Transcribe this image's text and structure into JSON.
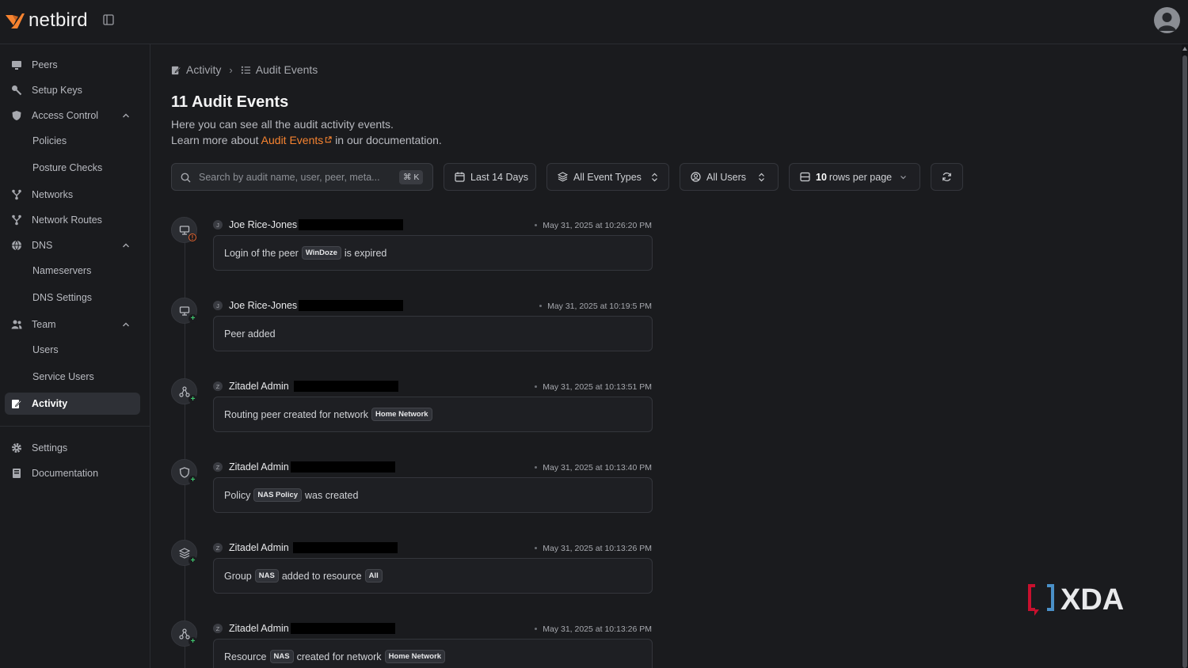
{
  "app": {
    "brand": "netbird",
    "accent": "#f68330"
  },
  "sidebar": {
    "items": [
      {
        "label": "Peers"
      },
      {
        "label": "Setup Keys"
      },
      {
        "label": "Access Control"
      },
      {
        "label": "Policies"
      },
      {
        "label": "Posture Checks"
      },
      {
        "label": "Networks"
      },
      {
        "label": "Network Routes"
      },
      {
        "label": "DNS"
      },
      {
        "label": "Nameservers"
      },
      {
        "label": "DNS Settings"
      },
      {
        "label": "Team"
      },
      {
        "label": "Users"
      },
      {
        "label": "Service Users"
      },
      {
        "label": "Activity"
      },
      {
        "label": "Settings"
      },
      {
        "label": "Documentation"
      }
    ],
    "active": "Activity"
  },
  "breadcrumb": {
    "parent": "Activity",
    "current": "Audit Events"
  },
  "header": {
    "title": "11 Audit Events",
    "description": "Here you can see all the audit activity events.",
    "learn_prefix": "Learn more about",
    "learn_link": "Audit Events",
    "learn_suffix": "in our documentation."
  },
  "filters": {
    "search_placeholder": "Search by audit name, user, peer, meta...",
    "search_shortcut": "⌘ K",
    "date_range": "Last 14 Days",
    "event_type": "All Event Types",
    "users": "All Users",
    "rows_value": "10",
    "rows_suffix": "rows per page"
  },
  "events": [
    {
      "initial": "J",
      "user": "Joe Rice-Jones",
      "time": "May 31, 2025 at 10:26:20 PM",
      "icon": "peer-expired-icon",
      "badge": "warning",
      "text_before": "Login of the peer",
      "chip": "WinDoze",
      "text_after": "is expired"
    },
    {
      "initial": "J",
      "user": "Joe Rice-Jones",
      "time": "May 31, 2025 at 10:19:5 PM",
      "icon": "peer-added-icon",
      "badge": "plus",
      "text_before": "Peer added"
    },
    {
      "initial": "Z",
      "user": "Zitadel Admin",
      "time": "May 31, 2025 at 10:13:51 PM",
      "icon": "routing-peer-icon",
      "badge": "plus",
      "text_before": "Routing peer created for network",
      "chip": "Home Network"
    },
    {
      "initial": "Z",
      "user": "Zitadel Admin",
      "time": "May 31, 2025 at 10:13:40 PM",
      "icon": "policy-shield-icon",
      "badge": "plus",
      "text_before": "Policy",
      "chip": "NAS Policy",
      "text_after": "was created"
    },
    {
      "initial": "Z",
      "user": "Zitadel Admin",
      "time": "May 31, 2025 at 10:13:26 PM",
      "icon": "group-layers-icon",
      "badge": "plus",
      "text_before": "Group",
      "chip": "NAS",
      "text_mid": "added to resource",
      "chip2": "All"
    },
    {
      "initial": "Z",
      "user": "Zitadel Admin",
      "time": "May 31, 2025 at 10:13:26 PM",
      "icon": "resource-network-icon",
      "badge": "plus",
      "text_before": "Resource",
      "chip": "NAS",
      "text_mid": "created for network",
      "chip2": "Home Network"
    }
  ],
  "watermark": {
    "text": "XDA"
  }
}
